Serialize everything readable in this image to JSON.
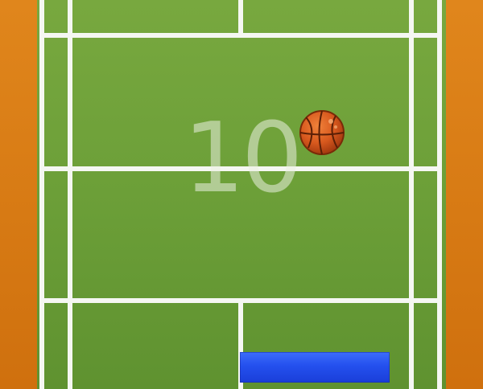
{
  "game": {
    "score": "10"
  },
  "colors": {
    "court": "#6c9f38",
    "surround": "#d77a14",
    "lines": "#f5f7f2",
    "paddle": "#2450ee",
    "ball": "#d8591e"
  },
  "icons": {
    "ball": "basketball-icon"
  }
}
